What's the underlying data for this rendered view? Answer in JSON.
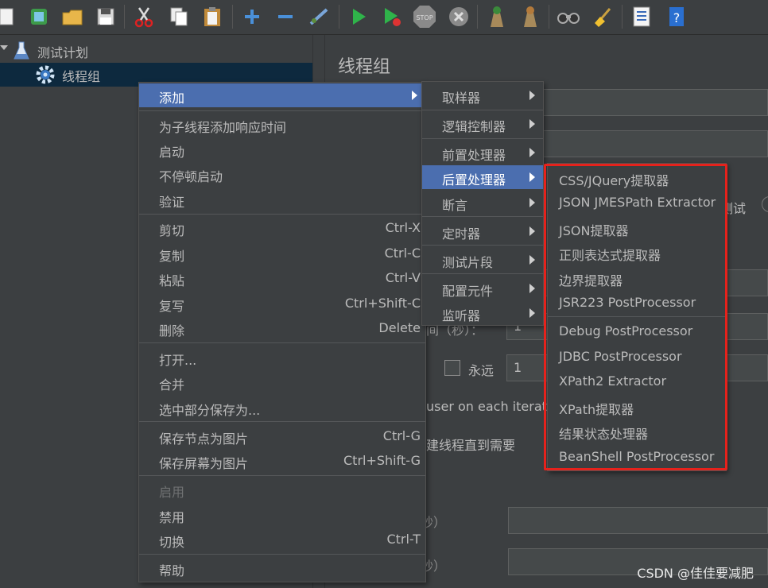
{
  "tree": {
    "items": [
      {
        "label": "测试计划",
        "icon": "flask-icon"
      },
      {
        "label": "线程组",
        "icon": "gear-icon"
      }
    ]
  },
  "panel": {
    "title": "线程组",
    "partial_texts": [
      "测试",
      "间（秒）：",
      "永远",
      "user on each iterati",
      "建线程直到需要",
      "秒）",
      "秒）"
    ],
    "fields": [
      "1",
      "1"
    ]
  },
  "context_menu": {
    "items": [
      {
        "label": "添加",
        "shortcut": "",
        "submenu": true,
        "highlighted": true
      },
      {
        "label": "为子线程添加响应时间",
        "shortcut": ""
      },
      {
        "label": "启动",
        "shortcut": ""
      },
      {
        "label": "不停顿启动",
        "shortcut": ""
      },
      {
        "label": "验证",
        "shortcut": ""
      },
      {
        "label": "剪切",
        "shortcut": "Ctrl-X"
      },
      {
        "label": "复制",
        "shortcut": "Ctrl-C"
      },
      {
        "label": "粘贴",
        "shortcut": "Ctrl-V"
      },
      {
        "label": "复写",
        "shortcut": "Ctrl+Shift-C"
      },
      {
        "label": "删除",
        "shortcut": "Delete"
      },
      {
        "label": "打开...",
        "shortcut": ""
      },
      {
        "label": "合并",
        "shortcut": ""
      },
      {
        "label": "选中部分保存为...",
        "shortcut": ""
      },
      {
        "label": "保存节点为图片",
        "shortcut": "Ctrl-G"
      },
      {
        "label": "保存屏幕为图片",
        "shortcut": "Ctrl+Shift-G"
      },
      {
        "label": "启用",
        "shortcut": "",
        "disabled": true
      },
      {
        "label": "禁用",
        "shortcut": ""
      },
      {
        "label": "切换",
        "shortcut": "Ctrl-T"
      },
      {
        "label": "帮助",
        "shortcut": ""
      }
    ]
  },
  "add_submenu": {
    "items": [
      {
        "label": "取样器"
      },
      {
        "label": "逻辑控制器"
      },
      {
        "label": "前置处理器"
      },
      {
        "label": "后置处理器",
        "highlighted": true
      },
      {
        "label": "断言"
      },
      {
        "label": "定时器"
      },
      {
        "label": "测试片段"
      },
      {
        "label": "配置元件"
      },
      {
        "label": "监听器"
      }
    ]
  },
  "post_processor_submenu": {
    "items": [
      {
        "label": "CSS/JQuery提取器"
      },
      {
        "label": "JSON JMESPath Extractor"
      },
      {
        "label": "JSON提取器"
      },
      {
        "label": "正则表达式提取器"
      },
      {
        "label": "边界提取器"
      },
      {
        "label": "JSR223 PostProcessor"
      },
      {
        "label": "Debug PostProcessor"
      },
      {
        "label": "JDBC PostProcessor"
      },
      {
        "label": "XPath2 Extractor"
      },
      {
        "label": "XPath提取器"
      },
      {
        "label": "结果状态处理器"
      },
      {
        "label": "BeanShell PostProcessor"
      }
    ]
  },
  "colors": {
    "background": "#3c3f41",
    "highlight": "#4b6eaf",
    "annotation_box": "#e6221c"
  },
  "watermark": "CSDN @佳佳要减肥"
}
